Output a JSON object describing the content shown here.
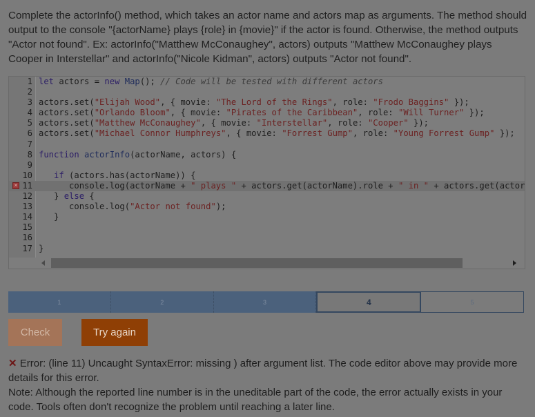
{
  "instructions": "Complete the actorInfo() method, which takes an actor name and actors map as arguments. The method should output to the console \"{actorName} plays {role} in {movie}\" if the actor is found. Otherwise, the method outputs \"Actor not found\". Ex: actorInfo(\"Matthew McConaughey\", actors) outputs \"Matthew McConaughey plays Cooper in Interstellar\" and actorInfo(\"Nicole Kidman\", actors) outputs \"Actor not found\".",
  "editor": {
    "error_line": 11,
    "active_line": 11,
    "lines": [
      {
        "n": "1",
        "code": "let actors = new Map(); // Code will be tested with different actors"
      },
      {
        "n": "2",
        "code": ""
      },
      {
        "n": "3",
        "code": "actors.set(\"Elijah Wood\", { movie: \"The Lord of the Rings\", role: \"Frodo Baggins\" });"
      },
      {
        "n": "4",
        "code": "actors.set(\"Orlando Bloom\", { movie: \"Pirates of the Caribbean\", role: \"Will Turner\" });"
      },
      {
        "n": "5",
        "code": "actors.set(\"Matthew McConaughey\", { movie: \"Interstellar\", role: \"Cooper\" });"
      },
      {
        "n": "6",
        "code": "actors.set(\"Michael Connor Humphreys\", { movie: \"Forrest Gump\", role: \"Young Forrest Gump\" });"
      },
      {
        "n": "7",
        "code": ""
      },
      {
        "n": "8",
        "code": "function actorInfo(actorName, actors) {"
      },
      {
        "n": "9",
        "code": ""
      },
      {
        "n": "10",
        "code": "   if (actors.has(actorName)) {"
      },
      {
        "n": "11",
        "code": "      console.log(actorName + \" plays \" + actors.get(actorName).role + \" in \" + actors.get(actorNa"
      },
      {
        "n": "12",
        "code": "   } else {"
      },
      {
        "n": "13",
        "code": "      console.log(\"Actor not found\");"
      },
      {
        "n": "14",
        "code": "   }"
      },
      {
        "n": "15",
        "code": ""
      },
      {
        "n": "16",
        "code": ""
      },
      {
        "n": "17",
        "code": "}"
      }
    ]
  },
  "progress": {
    "current": 4,
    "steps": [
      "1",
      "2",
      "3",
      "4",
      "5"
    ]
  },
  "buttons": {
    "check": "Check",
    "try_again": "Try again"
  },
  "error": {
    "icon": "x-icon",
    "line1": "Error: (line 11) Uncaught SyntaxError: missing ) after argument list. The code editor above may provide more details for this error.",
    "line2": "Note: Although the reported line number is in the uneditable part of the code, the error actually exists in your code. Tools often don't recognize the problem until reaching a later line."
  },
  "colors": {
    "progress_done": "#4b617c",
    "try_again": "#8f3f05",
    "check": "#a47458",
    "error_icon": "#6c1717"
  }
}
